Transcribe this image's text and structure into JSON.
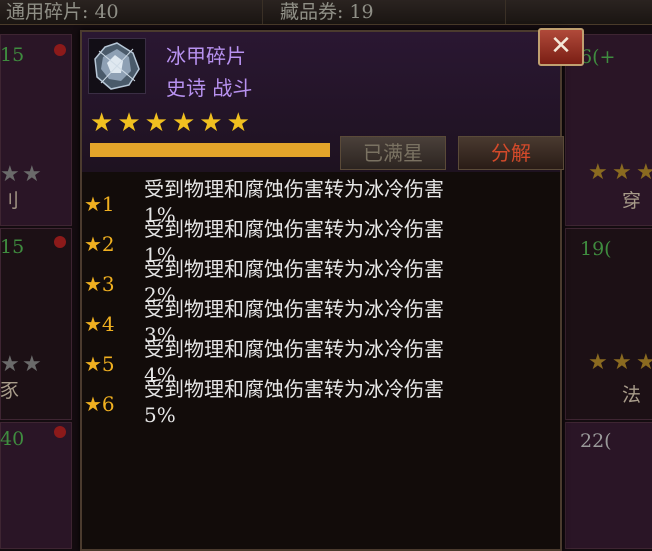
{
  "topbar": {
    "general_fragments": "通用碎片: 40",
    "collectible_tickets": "藏品券: 19"
  },
  "background": {
    "left_labels": [
      "15",
      "15",
      "40"
    ],
    "right_labels": [
      "6(+",
      "19(",
      "22("
    ],
    "right_texts": [
      "穿",
      "法"
    ],
    "left_texts": [
      "刂",
      "豕"
    ]
  },
  "item": {
    "name": "冰甲碎片",
    "rarity": "史诗 战斗",
    "star_count": 6,
    "stars": [
      "★",
      "★",
      "★",
      "★",
      "★",
      "★"
    ],
    "progress_fraction": 1.0,
    "maxed_label": "已满星",
    "decompose_label": "分解",
    "close_glyph": "✕"
  },
  "effects": [
    {
      "level": "★1",
      "text": "受到物理和腐蚀伤害转为冰冷伤害",
      "value": "1%"
    },
    {
      "level": "★2",
      "text": "受到物理和腐蚀伤害转为冰冷伤害",
      "value": "1%"
    },
    {
      "level": "★3",
      "text": "受到物理和腐蚀伤害转为冰冷伤害",
      "value": "2%"
    },
    {
      "level": "★4",
      "text": "受到物理和腐蚀伤害转为冰冷伤害",
      "value": "3%"
    },
    {
      "level": "★5",
      "text": "受到物理和腐蚀伤害转为冰冷伤害",
      "value": "4%"
    },
    {
      "level": "★6",
      "text": "受到物理和腐蚀伤害转为冰冷伤害",
      "value": "5%"
    }
  ],
  "colors": {
    "epic_purple": "#b892f0",
    "star_gold": "#f0c020",
    "decompose_red": "#d44a2a"
  }
}
